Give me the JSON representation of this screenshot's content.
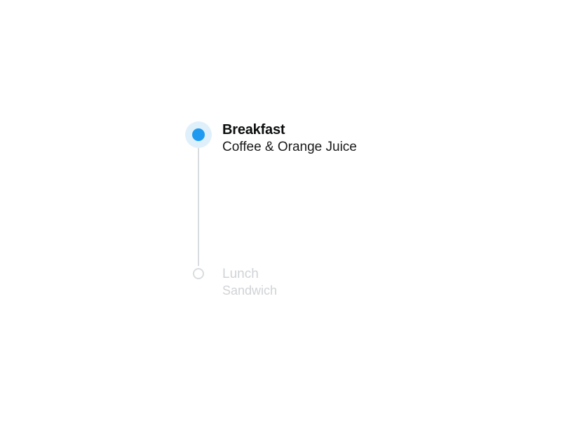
{
  "timeline": {
    "items": [
      {
        "title": "Breakfast",
        "subtitle": "Coffee & Orange Juice",
        "active": true
      },
      {
        "title": "Lunch",
        "subtitle": "Sandwich",
        "active": false
      }
    ]
  }
}
